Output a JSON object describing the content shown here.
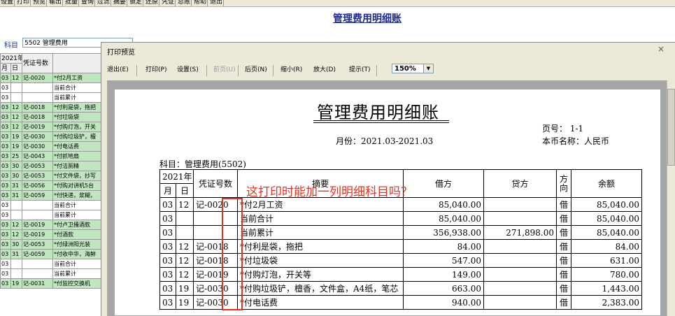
{
  "toolbar": {
    "items": [
      "设置",
      "打印",
      "预览",
      "输出",
      "批量",
      "查询",
      "过滤",
      "摘要",
      "锁定",
      "还原",
      "凭证",
      "总账",
      "帮助",
      "退出"
    ]
  },
  "title": "管理费用明细账",
  "subject": {
    "label": "科目",
    "value": "5502 管理费用"
  },
  "bg_table": {
    "header": [
      "2021年",
      "凭证号数"
    ],
    "subheader": [
      "月",
      "日"
    ],
    "rows": [
      {
        "m": "03",
        "d": "12",
        "v": "记-0020",
        "s": "*付2月工资",
        "c": "g"
      },
      {
        "m": "03",
        "d": "",
        "v": "",
        "s": "当前合计",
        "c": "w"
      },
      {
        "m": "03",
        "d": "",
        "v": "",
        "s": "当前累计",
        "c": "w"
      },
      {
        "m": "03",
        "d": "12",
        "v": "记-0018",
        "s": "*付利是袋，拖把",
        "c": "g"
      },
      {
        "m": "03",
        "d": "12",
        "v": "记-0018",
        "s": "*付垃圾袋",
        "c": "g"
      },
      {
        "m": "03",
        "d": "12",
        "v": "记-0019",
        "s": "*付购灯泡，开关",
        "c": "g"
      },
      {
        "m": "03",
        "d": "19",
        "v": "记-0030",
        "s": "*付购垃圾铲，檀",
        "c": "g"
      },
      {
        "m": "03",
        "d": "19",
        "v": "记-0030",
        "s": "*付电话费",
        "c": "g"
      },
      {
        "m": "03",
        "d": "25",
        "v": "记-0043",
        "s": "*付抓地扇",
        "c": "g"
      },
      {
        "m": "03",
        "d": "30",
        "v": "记-0053",
        "s": "*付洁厕精",
        "c": "g"
      },
      {
        "m": "03",
        "d": "30",
        "v": "记-0053",
        "s": "*付文件袋，抄写",
        "c": "g"
      },
      {
        "m": "03",
        "d": "31",
        "v": "记-0056",
        "s": "*付购对讲机5台",
        "c": "g"
      },
      {
        "m": "03",
        "d": "31",
        "v": "记-0059",
        "s": "*付快递，浆糊，",
        "c": "g"
      },
      {
        "m": "03",
        "d": "",
        "v": "",
        "s": "当前合计",
        "c": "w"
      },
      {
        "m": "03",
        "d": "",
        "v": "",
        "s": "当前累计",
        "c": "w"
      },
      {
        "m": "03",
        "d": "12",
        "v": "记-0019",
        "s": "*付卢卫搔酒款",
        "c": "g"
      },
      {
        "m": "03",
        "d": "12",
        "v": "记-0019",
        "s": "*付酒款",
        "c": "g"
      },
      {
        "m": "03",
        "d": "30",
        "v": "记-0053",
        "s": "*付绿洲阳光装",
        "c": "g"
      },
      {
        "m": "03",
        "d": "31",
        "v": "记-0059",
        "s": "*付收中华，海鲜",
        "c": "g"
      },
      {
        "m": "03",
        "d": "",
        "v": "",
        "s": "当前合计",
        "c": "w"
      },
      {
        "m": "03",
        "d": "",
        "v": "",
        "s": "当前累计",
        "c": "w"
      },
      {
        "m": "03",
        "d": "19",
        "v": "记-0031",
        "s": "*付监控交换机",
        "c": "g"
      }
    ]
  },
  "preview": {
    "window_title": "打印预览",
    "close": "×",
    "buttons": [
      {
        "label": "退出(E)",
        "enabled": true
      },
      {
        "label": "打印(P)",
        "enabled": true
      },
      {
        "label": "设置(S)",
        "enabled": true
      },
      {
        "label": "前页(U)",
        "enabled": false
      },
      {
        "label": "后页(N)",
        "enabled": true
      },
      {
        "label": "缩小(R)",
        "enabled": true
      },
      {
        "label": "放大(D)",
        "enabled": true
      },
      {
        "label": "提示(T)",
        "enabled": true
      }
    ],
    "zoom": "150%"
  },
  "paper": {
    "title": "管理费用明细账",
    "page_no": "页号：  1-1",
    "month": "月份：2021.03-2021.03",
    "currency": "本币名称：人民币",
    "subject": "科目：管理费用(5502)",
    "headers": {
      "year": "2021年",
      "month": "月",
      "day": "日",
      "voucher": "凭证号数",
      "summary": "摘要",
      "debit": "借方",
      "credit": "贷方",
      "direction": "方向",
      "balance": "余额"
    },
    "rows": [
      {
        "m": "03",
        "d": "12",
        "v": "记-0020",
        "s": "*付2月工资",
        "dr": "85,040.00",
        "cr": "",
        "dir": "借",
        "bal": "85,040.00"
      },
      {
        "m": "03",
        "d": "",
        "v": "",
        "s": "当前合计",
        "dr": "85,040.00",
        "cr": "",
        "dir": "借",
        "bal": "85,040.00"
      },
      {
        "m": "03",
        "d": "",
        "v": "",
        "s": "当前累计",
        "dr": "356,938.00",
        "cr": "271,898.00",
        "dir": "借",
        "bal": "85,040.00"
      },
      {
        "m": "03",
        "d": "12",
        "v": "记-0018",
        "s": "*付利是袋，拖把",
        "dr": "84.00",
        "cr": "",
        "dir": "借",
        "bal": "84.00"
      },
      {
        "m": "03",
        "d": "12",
        "v": "记-0018",
        "s": "*付垃圾袋",
        "dr": "547.00",
        "cr": "",
        "dir": "借",
        "bal": "631.00"
      },
      {
        "m": "03",
        "d": "12",
        "v": "记-0019",
        "s": "*付购灯泡，开关等",
        "dr": "149.00",
        "cr": "",
        "dir": "借",
        "bal": "780.00"
      },
      {
        "m": "03",
        "d": "19",
        "v": "记-0030",
        "s": "*付购垃圾铲，檀香，文件盒，A4纸，笔芯",
        "dr": "663.00",
        "cr": "",
        "dir": "借",
        "bal": "1,443.00"
      },
      {
        "m": "03",
        "d": "19",
        "v": "记-0030",
        "s": "*付电话费",
        "dr": "940.00",
        "cr": "",
        "dir": "借",
        "bal": "2,383.00"
      }
    ]
  },
  "annotation": {
    "text": "这打印时能加一列明细科目吗？",
    "color": "#e53020"
  }
}
